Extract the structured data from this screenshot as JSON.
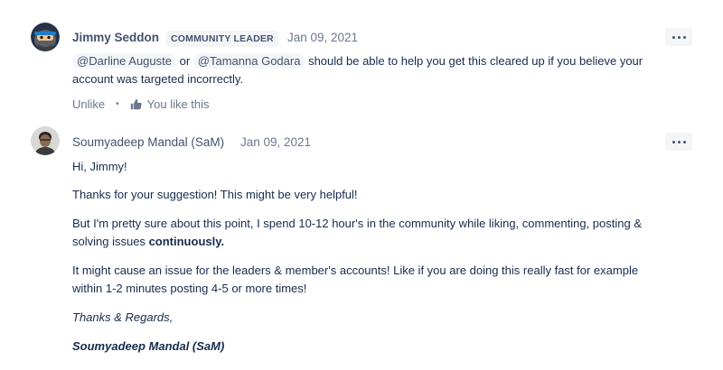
{
  "comment1": {
    "author": "Jimmy Seddon",
    "badge": "COMMUNITY LEADER",
    "date": "Jan 09, 2021",
    "mention1": "@Darline Auguste",
    "or_text": "or",
    "mention2": "@Tamanna Godara",
    "body_rest": "should be able to help you get this cleared up if you believe your",
    "body_line2": "account was targeted incorrectly.",
    "unlike_label": "Unlike",
    "likes_text": "You like this",
    "avatar_icon": "avatar-ninja-icon"
  },
  "comment2": {
    "author": "Soumyadeep Mandal (SaM)",
    "date": "Jan 09, 2021",
    "avatar_icon": "avatar-photo-icon",
    "p1": "Hi, Jimmy!",
    "p2": "Thanks for your suggestion! This might be very helpful!",
    "p3_line1": "But I'm pretty sure about this point, I spend 10-12 hour's in the community while liking, commenting, posting &",
    "p3_line2_prefix": "solving issues",
    "p3_line2_bold": "continuously.",
    "p4_line1": "It might cause an issue for the leaders & member's accounts! Like if you are doing this really fast for example",
    "p4_line2": "within 1-2 minutes posting 4-5 or more times!",
    "p5": "Thanks & Regards,",
    "p6": "Soumyadeep Mandal (SaM)"
  },
  "colors": {
    "author": "#42526e",
    "text": "#172b4d",
    "meta": "#6b778c",
    "chip_bg": "#f4f5f7"
  }
}
